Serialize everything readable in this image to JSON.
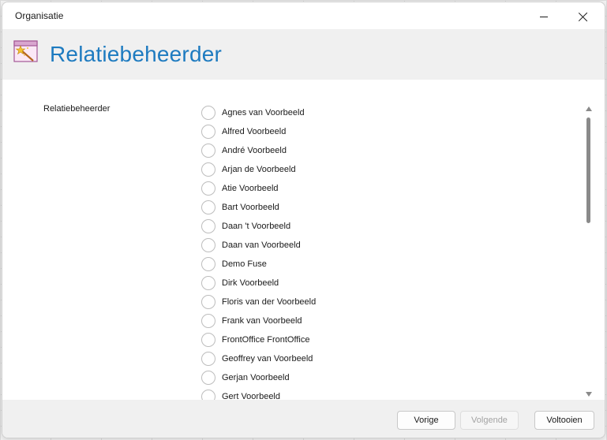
{
  "window": {
    "title": "Organisatie"
  },
  "header": {
    "title": "Relatiebeheerder",
    "icon": "wizard-wand-icon",
    "title_color": "#1e7bc0"
  },
  "form": {
    "label": "Relatiebeheerder",
    "options": [
      "Agnes van Voorbeeld",
      "Alfred Voorbeeld",
      "André Voorbeeld",
      "Arjan de Voorbeeld",
      "Atie Voorbeeld",
      "Bart Voorbeeld",
      "Daan 't Voorbeeld",
      "Daan van Voorbeeld",
      "Demo Fuse",
      "Dirk Voorbeeld",
      "Floris van der Voorbeeld",
      "Frank van Voorbeeld",
      "FrontOffice FrontOffice",
      "Geoffrey van Voorbeeld",
      "Gerjan Voorbeeld",
      "Gert Voorbeeld"
    ]
  },
  "buttons": {
    "previous": "Vorige",
    "next": "Volgende",
    "finish": "Voltooien"
  }
}
